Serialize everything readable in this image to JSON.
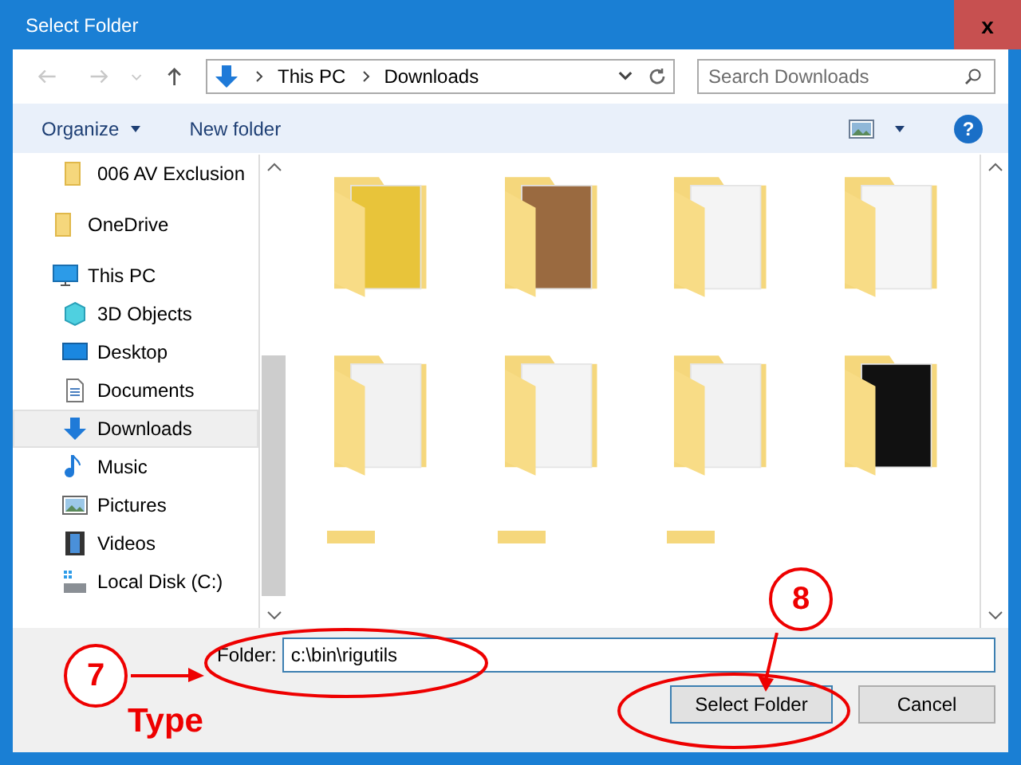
{
  "window": {
    "title": "Select Folder",
    "close": "x"
  },
  "nav": {
    "breadcrumb": [
      "This PC",
      "Downloads"
    ],
    "search": {
      "placeholder": "Search Downloads"
    }
  },
  "toolbar": {
    "organize": "Organize",
    "new_folder": "New folder",
    "help": "?"
  },
  "sidebar": {
    "items": [
      {
        "children": [
          {
            "label": "006 AV Exclusion",
            "selected": false
          }
        ]
      },
      {
        "label": "OneDrive",
        "selected": false
      },
      {
        "label": "This PC",
        "selected": false,
        "children": [
          {
            "label": "3D Objects",
            "selected": false
          },
          {
            "label": "Desktop",
            "selected": false
          },
          {
            "label": "Documents",
            "selected": false
          },
          {
            "label": "Downloads",
            "selected": true
          },
          {
            "label": "Music",
            "selected": false
          },
          {
            "label": "Pictures",
            "selected": false
          },
          {
            "label": "Videos",
            "selected": false
          },
          {
            "label": "Local Disk (C:)",
            "selected": false
          }
        ]
      }
    ]
  },
  "content": {
    "folders": [
      {
        "kind": "disc"
      },
      {
        "kind": "photo"
      },
      {
        "kind": "paper"
      },
      {
        "kind": "chip"
      },
      {
        "kind": "gear"
      },
      {
        "kind": "paper"
      },
      {
        "kind": "app"
      },
      {
        "kind": "dark"
      },
      {
        "kind": "top"
      },
      {
        "kind": "top"
      },
      {
        "kind": "top"
      }
    ]
  },
  "footer": {
    "folder_label": "Folder:",
    "folder_value": "c:\\bin\\rigutils",
    "buttons": [
      "Select Folder",
      "Cancel"
    ]
  },
  "annotations": [
    {
      "kind": "step",
      "number": "7",
      "note": "Type"
    },
    {
      "kind": "step",
      "number": "8"
    }
  ]
}
